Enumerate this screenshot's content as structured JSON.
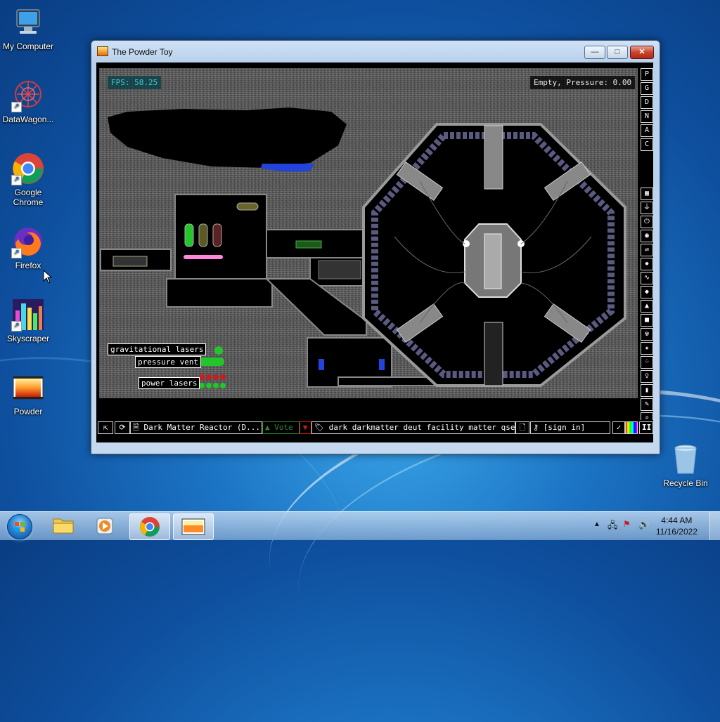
{
  "desktop": {
    "icons": [
      {
        "label": "My Computer"
      },
      {
        "label": "DataWagon..."
      },
      {
        "label": "Google Chrome"
      },
      {
        "label": "Firefox"
      },
      {
        "label": "Skyscraper"
      },
      {
        "label": "Powder"
      },
      {
        "label": "Recycle Bin"
      }
    ]
  },
  "window": {
    "title": "The Powder Toy",
    "min": "—",
    "max": "□",
    "close": "✕"
  },
  "game": {
    "fps": "FPS: 58.25",
    "status": "Empty, Pressure: 0.00",
    "labels": {
      "grav": "gravitational lasers",
      "vent": "pressure vent",
      "power": "power lasers"
    },
    "modes": [
      "P",
      "G",
      "D",
      "N",
      "A",
      "C"
    ],
    "menu_icons": [
      "walls-icon",
      "electronics-icon",
      "power-icon",
      "sensor-icon",
      "force-icon",
      "explosives-icon",
      "gases-icon",
      "liquids-icon",
      "powders-icon",
      "solids-icon",
      "radioactive-icon",
      "special-icon",
      "life-icon",
      "tools-icon",
      "favorite-icon",
      "decoration-icon",
      "search-icon"
    ],
    "bottom": {
      "open": "⇱",
      "reload": "⟳",
      "save_name": "Dark Matter Reactor (D...",
      "vote": "Vote",
      "tags": "dark darkmatter deut facility matter qse...",
      "signin": "[sign in]",
      "pause": "II"
    }
  },
  "taskbar": {
    "time": "4:44 AM",
    "date": "11/16/2022"
  }
}
